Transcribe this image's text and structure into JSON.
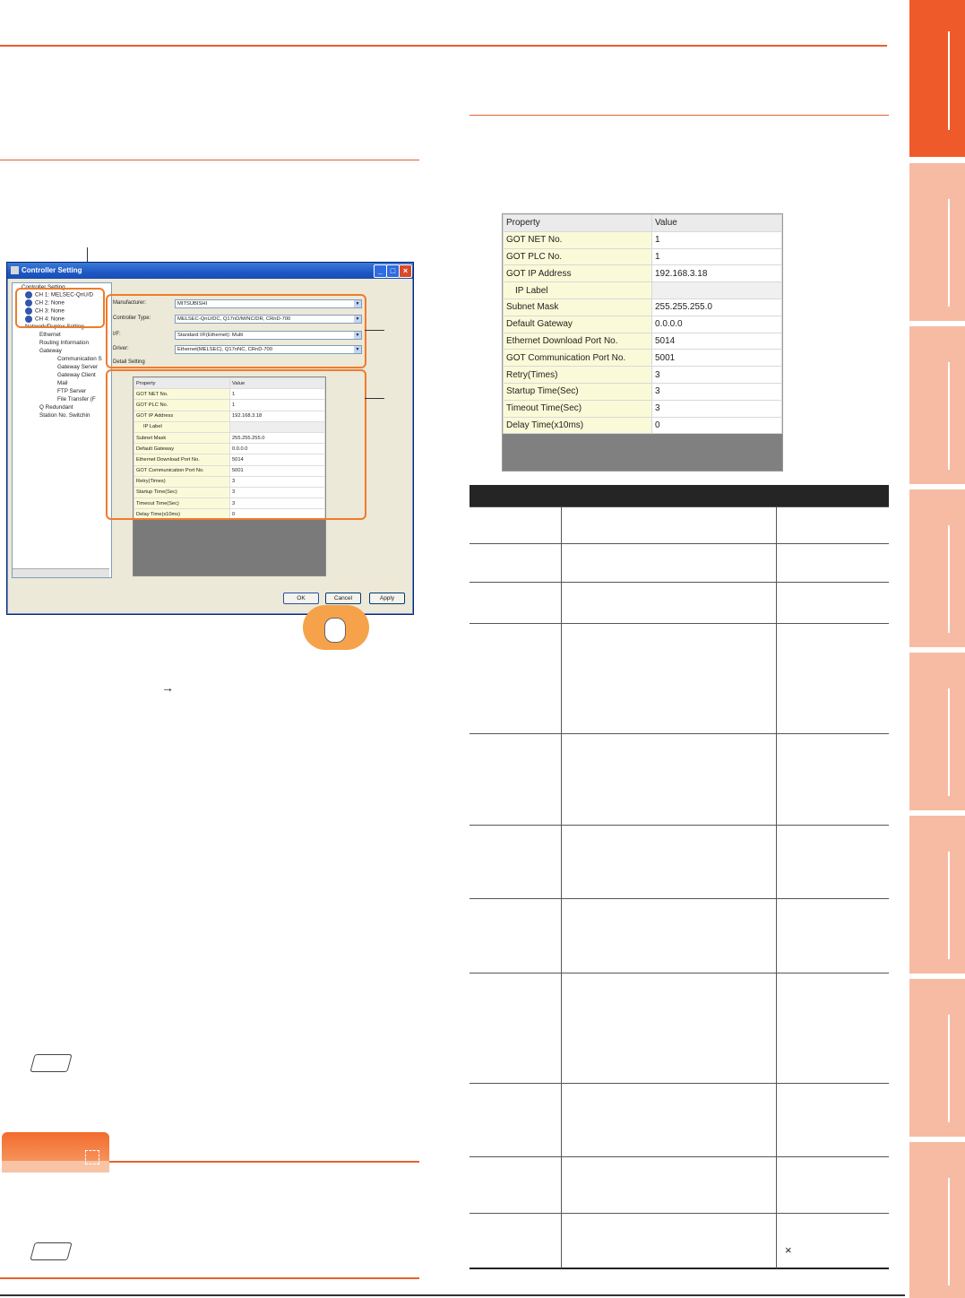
{
  "colors": {
    "accent": "#ef5a2a",
    "tab": "#f7bba3",
    "table_head": "#252525"
  },
  "dialog": {
    "title": "Controller Setting",
    "tree": {
      "root": "Controller Setting",
      "channels": [
        "CH 1: MELSEC-QnU/D",
        "CH 2: None",
        "CH 3: None",
        "CH 4: None"
      ],
      "network": "Network/Duplex Setting",
      "items": [
        "Ethernet",
        "Routing Information",
        "Gateway",
        "Communication S",
        "Gateway Server",
        "Gateway Client",
        "Mail",
        "FTP Server",
        "File Transfer (F",
        "Q Redundant",
        "Station No. Switchin"
      ]
    },
    "manufacturer_label": "Manufacturer:",
    "manufacturer_value": "MITSUBISHI",
    "controller_type_label": "Controller Type:",
    "controller_type_value": "MELSEC-QnU/DC, Q17nD/M/NC/DR, CRnD-700",
    "if_label": "I/F:",
    "if_value": "Standard I/F(Ethernet): Multi",
    "driver_label": "Driver:",
    "driver_value": "Ethernet(MELSEC), Q17nNC, CRnD-700",
    "detail_setting": "Detail Setting",
    "buttons": {
      "ok": "OK",
      "cancel": "Cancel",
      "apply": "Apply"
    }
  },
  "property_table": {
    "header": [
      "Property",
      "Value"
    ],
    "rows": [
      [
        "GOT NET No.",
        "1"
      ],
      [
        "GOT PLC No.",
        "1"
      ],
      [
        "GOT IP Address",
        "192.168.3.18"
      ],
      [
        "IP Label",
        ""
      ],
      [
        "Subnet Mask",
        "255.255.255.0"
      ],
      [
        "Default Gateway",
        "0.0.0.0"
      ],
      [
        "Ethernet Download Port No.",
        "5014"
      ],
      [
        "GOT Communication Port No.",
        "5001"
      ],
      [
        "Retry(Times)",
        "3"
      ],
      [
        "Startup Time(Sec)",
        "3"
      ],
      [
        "Timeout Time(Sec)",
        "3"
      ],
      [
        "Delay Time(x10ms)",
        "0"
      ]
    ]
  },
  "mini_table": {
    "header": [
      "Property",
      "Value"
    ],
    "rows": [
      [
        "GOT NET No.",
        "1"
      ],
      [
        "GOT PLC No.",
        "1"
      ],
      [
        "GOT IP Address",
        "192.168.3.18"
      ],
      [
        "IP Label",
        ""
      ],
      [
        "Subnet Mask",
        "255.255.255.0"
      ],
      [
        "Default Gateway",
        "0.0.0.0"
      ],
      [
        "Ethernet Download Port No.",
        "5014"
      ],
      [
        "GOT Communication Port No.",
        "5001"
      ],
      [
        "Retry(Times)",
        "3"
      ],
      [
        "Startup Time(Sec)",
        "3"
      ],
      [
        "Timeout Time(Sec)",
        "3"
      ],
      [
        "Delay Time(x10ms)",
        "0"
      ]
    ]
  },
  "arrow_glyph": "→",
  "lower_table_last_mark": "×"
}
